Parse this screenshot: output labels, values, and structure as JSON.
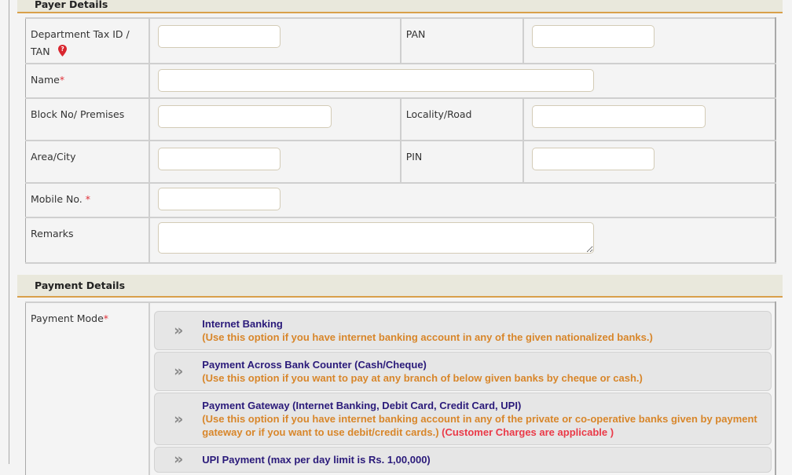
{
  "sections": {
    "payer": {
      "title": "Payer Details"
    },
    "payment": {
      "title": "Payment Details"
    }
  },
  "payer": {
    "dept_tax_id": {
      "label_line1": "Department Tax ID /",
      "label_line2": "TAN",
      "value": "",
      "help_icon": "map-marker-question-icon"
    },
    "pan": {
      "label": "PAN",
      "value": ""
    },
    "name": {
      "label": "Name",
      "required_mark": "*",
      "value": ""
    },
    "block": {
      "label": "Block No/ Premises",
      "value": ""
    },
    "locality": {
      "label": "Locality/Road",
      "value": ""
    },
    "area": {
      "label": "Area/City",
      "value": ""
    },
    "pin": {
      "label": "PIN",
      "value": ""
    },
    "mobile": {
      "label": "Mobile No. ",
      "required_mark": "*",
      "value": ""
    },
    "remarks": {
      "label": "Remarks",
      "value": ""
    }
  },
  "payment": {
    "mode_label": "Payment Mode",
    "required_mark": "*",
    "chevron_icon": "double-chevron-right-icon",
    "options": [
      {
        "title": "Internet Banking",
        "desc": "(Use this option if you have internet banking account in any of the given nationalized banks.)",
        "warn": ""
      },
      {
        "title": "Payment Across Bank Counter (Cash/Cheque)",
        "desc": "(Use this option if you want to pay at any branch of below given banks by cheque or cash.)",
        "warn": ""
      },
      {
        "title": "Payment Gateway (Internet Banking, Debit Card, Credit Card, UPI)",
        "desc": "(Use this option if you have internet banking account in any of the private or co-operative banks given by payment gateway or if you want to use debit/credit cards.)",
        "warn": " (Customer Charges are applicable )"
      },
      {
        "title": "UPI Payment (max per day limit is Rs. 1,00,000)",
        "desc": "",
        "warn": ""
      }
    ]
  },
  "colors": {
    "section_underline": "#d9a04a",
    "option_title": "#2a1a7a",
    "option_desc": "#d8862a",
    "warning": "#ea3a48",
    "required": "#e0323a"
  }
}
